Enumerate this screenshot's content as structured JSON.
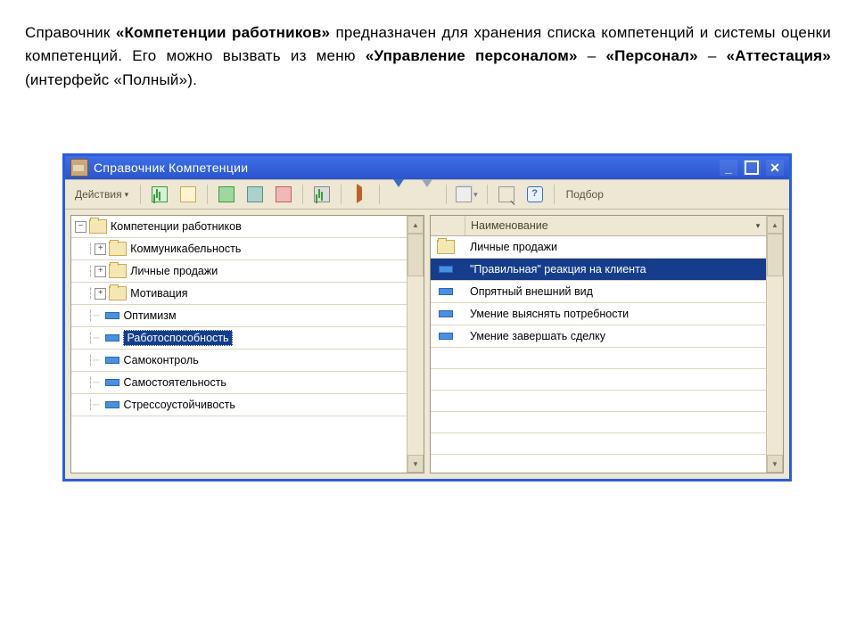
{
  "doc": {
    "p1a": "Справочник ",
    "p1b": "«Компетенции работников»",
    "p1c": " предназначен для хранения списка компетенций и системы оценки компетенций. Его можно вызвать из меню ",
    "p1d": "«Управление персоналом»",
    "p1e": " – ",
    "p1f": "«Персонал»",
    "p1g": " – ",
    "p1h": "«Аттестация»",
    "p1i": " (интерфейс «Полный»)."
  },
  "window": {
    "title": "Справочник Компетенции"
  },
  "toolbar": {
    "actions": "Действия",
    "selection": "Подбор"
  },
  "tree": {
    "root": "Компетенции работников",
    "folders": [
      "Коммуникабельность",
      "Личные продажи",
      "Мотивация"
    ],
    "leaves": [
      "Оптимизм",
      "Работоспособность",
      "Самоконтроль",
      "Самостоятельность",
      "Стрессоустойчивость"
    ],
    "selected_index": 1
  },
  "grid": {
    "header": "Наименование",
    "rows": [
      {
        "type": "folder",
        "text": "Личные продажи",
        "sel": false
      },
      {
        "type": "item",
        "text": "\"Правильная\" реакция на клиента",
        "sel": true
      },
      {
        "type": "item",
        "text": "Опрятный внешний вид",
        "sel": false
      },
      {
        "type": "item",
        "text": "Умение выяснять потребности",
        "sel": false
      },
      {
        "type": "item",
        "text": "Умение завершать сделку",
        "sel": false
      }
    ]
  }
}
